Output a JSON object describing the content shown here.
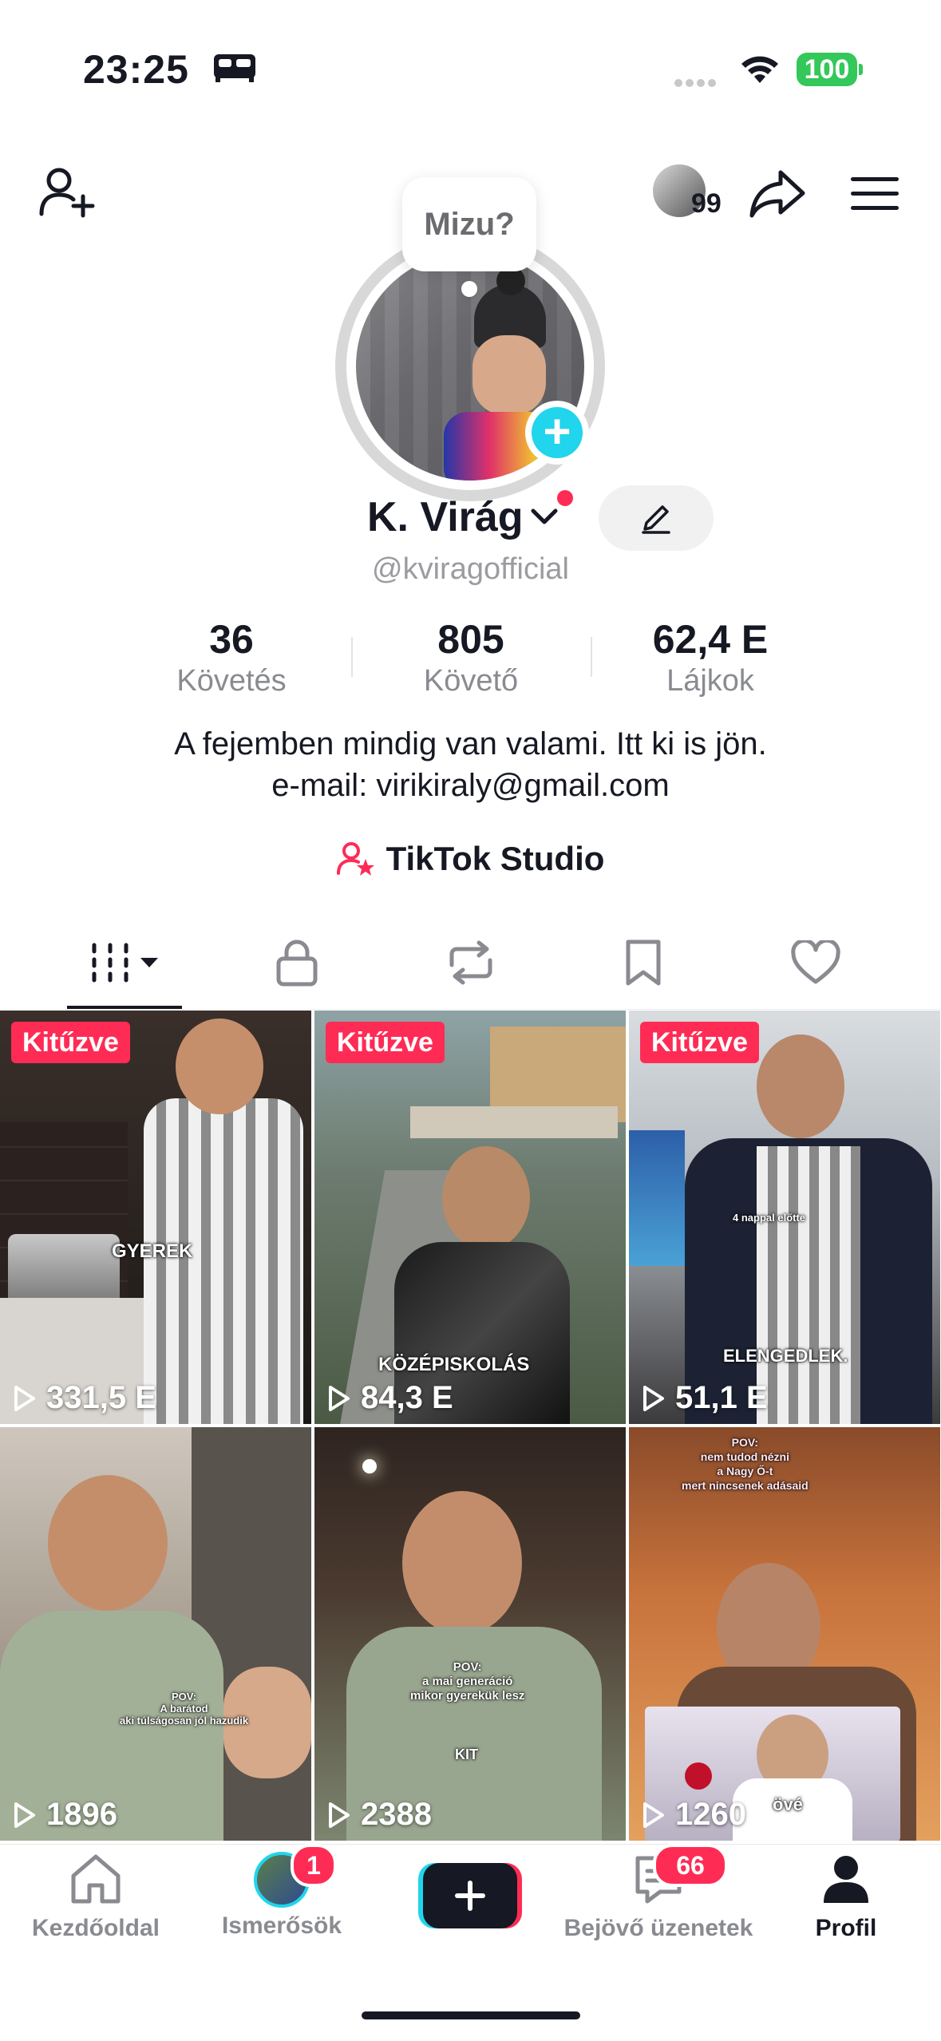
{
  "status_bar": {
    "time": "23:25",
    "battery": "100"
  },
  "top_bar": {
    "stories_count": "99"
  },
  "profile": {
    "bubble_text": "Mizu?",
    "name": "K. Virág",
    "handle": "@kviragofficial",
    "stats": [
      {
        "value": "36",
        "label": "Követés"
      },
      {
        "value": "805",
        "label": "Követő"
      },
      {
        "value": "62,4 E",
        "label": "Lájkok"
      }
    ],
    "bio_line1": "A fejemben mindig van valami. Itt ki is jön.",
    "bio_line2": "e-mail: virikiraly@gmail.com",
    "studio_label": "TikTok Studio"
  },
  "tabs": [
    "videos-tab",
    "private-tab",
    "reposts-tab",
    "favorites-tab",
    "liked-tab"
  ],
  "videos": [
    {
      "pinned": "Kitűzve",
      "views": "331,5 E",
      "caption": "GYEREK"
    },
    {
      "pinned": "Kitűzve",
      "views": "84,3 E",
      "caption": "KÖZÉPISKOLÁS"
    },
    {
      "pinned": "Kitűzve",
      "views": "51,1 E",
      "caption": "ELENGEDLEK.",
      "caption_top": "4 nappal előtte"
    },
    {
      "views": "1896",
      "caption": "POV:\nA barátod\naki túlságosan jól hazudik"
    },
    {
      "views": "2388",
      "caption": "POV:\na mai generáció\nmikor gyerekük lesz",
      "caption2": "KIT"
    },
    {
      "views": "1260",
      "caption": "POV:\nnem tudod nézni\na Nagy Ő-t\nmert nincsenek adásaid",
      "caption2": "övé"
    }
  ],
  "nav": {
    "home": "Kezdőoldal",
    "friends": "Ismerősök",
    "friends_badge": "1",
    "inbox": "Bejövő üzenetek",
    "inbox_badge": "66",
    "profile": "Profil"
  },
  "colors": {
    "accent": "#fe2c55",
    "cyan": "#20d5ec",
    "battery": "#34c759"
  }
}
